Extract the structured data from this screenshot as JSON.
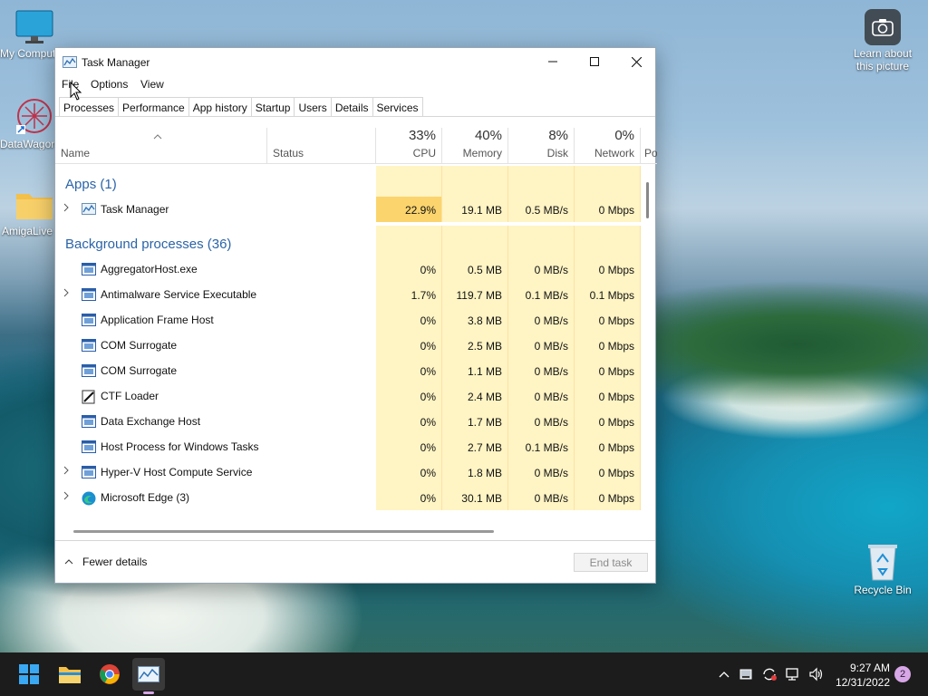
{
  "desktop": {
    "icons": [
      {
        "label": "My Computer"
      },
      {
        "label": "DataWagon"
      },
      {
        "label": "AmigaLive"
      },
      {
        "label": "Learn about this picture"
      },
      {
        "label": "Recycle Bin"
      }
    ]
  },
  "window": {
    "title": "Task Manager",
    "menu": [
      "File",
      "Options",
      "View"
    ],
    "tabs": [
      "Processes",
      "Performance",
      "App history",
      "Startup",
      "Users",
      "Details",
      "Services"
    ],
    "columns": {
      "name": "Name",
      "status": "Status",
      "cpu": {
        "pct": "33%",
        "label": "CPU"
      },
      "memory": {
        "pct": "40%",
        "label": "Memory"
      },
      "disk": {
        "pct": "8%",
        "label": "Disk"
      },
      "network": {
        "pct": "0%",
        "label": "Network"
      },
      "power": "Po"
    },
    "groups": {
      "apps": "Apps (1)",
      "background": "Background processes (36)"
    },
    "apps": [
      {
        "name": "Task Manager",
        "cpu": "22.9%",
        "memory": "19.1 MB",
        "disk": "0.5 MB/s",
        "network": "0 Mbps",
        "expandable": true
      }
    ],
    "background": [
      {
        "name": "AggregatorHost.exe",
        "cpu": "0%",
        "memory": "0.5 MB",
        "disk": "0 MB/s",
        "network": "0 Mbps",
        "expandable": false
      },
      {
        "name": "Antimalware Service Executable",
        "cpu": "1.7%",
        "memory": "119.7 MB",
        "disk": "0.1 MB/s",
        "network": "0.1 Mbps",
        "expandable": true
      },
      {
        "name": "Application Frame Host",
        "cpu": "0%",
        "memory": "3.8 MB",
        "disk": "0 MB/s",
        "network": "0 Mbps",
        "expandable": false
      },
      {
        "name": "COM Surrogate",
        "cpu": "0%",
        "memory": "2.5 MB",
        "disk": "0 MB/s",
        "network": "0 Mbps",
        "expandable": false
      },
      {
        "name": "COM Surrogate",
        "cpu": "0%",
        "memory": "1.1 MB",
        "disk": "0 MB/s",
        "network": "0 Mbps",
        "expandable": false
      },
      {
        "name": "CTF Loader",
        "cpu": "0%",
        "memory": "2.4 MB",
        "disk": "0 MB/s",
        "network": "0 Mbps",
        "expandable": false
      },
      {
        "name": "Data Exchange Host",
        "cpu": "0%",
        "memory": "1.7 MB",
        "disk": "0 MB/s",
        "network": "0 Mbps",
        "expandable": false
      },
      {
        "name": "Host Process for Windows Tasks",
        "cpu": "0%",
        "memory": "2.7 MB",
        "disk": "0.1 MB/s",
        "network": "0 Mbps",
        "expandable": false
      },
      {
        "name": "Hyper-V Host Compute Service",
        "cpu": "0%",
        "memory": "1.8 MB",
        "disk": "0 MB/s",
        "network": "0 Mbps",
        "expandable": true
      },
      {
        "name": "Microsoft Edge (3)",
        "cpu": "0%",
        "memory": "30.1 MB",
        "disk": "0 MB/s",
        "network": "0 Mbps",
        "expandable": true
      }
    ],
    "footer": {
      "fewer_details": "Fewer details",
      "end_task": "End task"
    }
  },
  "taskbar": {
    "clock_time": "9:27 AM",
    "clock_date": "12/31/2022",
    "notification_count": "2"
  },
  "colors": {
    "cpu_hot": "#fbd46d",
    "heat_light": "#fff4c4",
    "group_blue": "#2a64a8"
  }
}
